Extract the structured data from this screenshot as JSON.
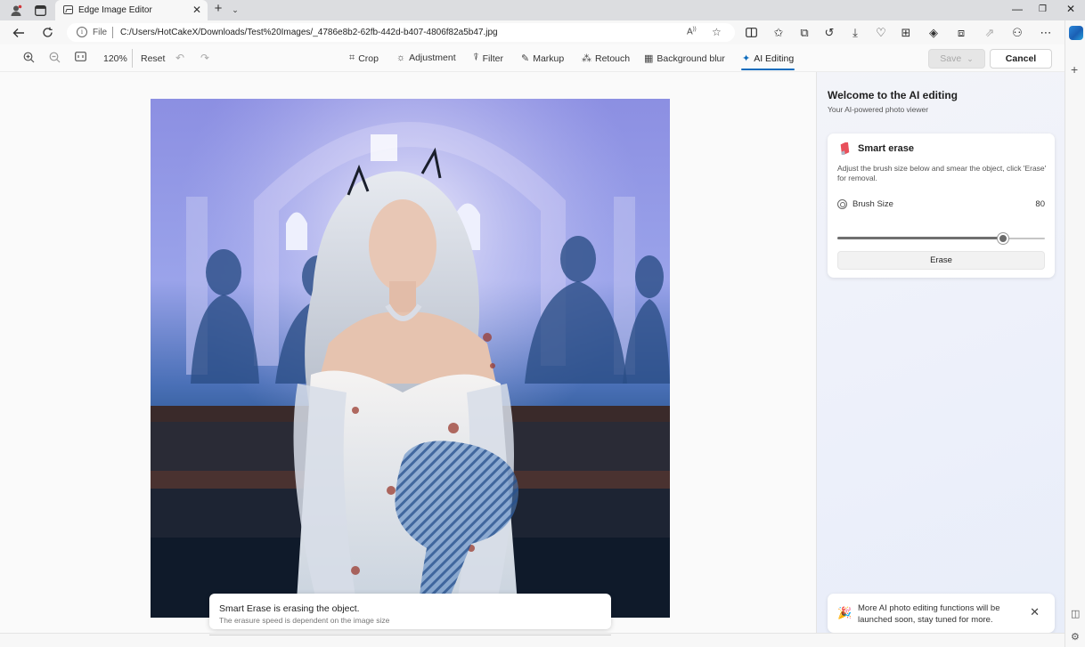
{
  "tab": {
    "title": "Edge Image Editor"
  },
  "address": {
    "scheme_label": "File",
    "url": "C:/Users/HotCakeX/Downloads/Test%20Images/_4786e8b2-62fb-442d-b407-4806f82a5b47.jpg"
  },
  "toolbar": {
    "zoom": "120%",
    "reset": "Reset",
    "crop": "Crop",
    "adjustment": "Adjustment",
    "filter": "Filter",
    "markup": "Markup",
    "retouch": "Retouch",
    "background_blur": "Background blur",
    "ai_editing": "AI Editing",
    "save": "Save",
    "cancel": "Cancel"
  },
  "toast": {
    "title": "Smart Erase is erasing the object.",
    "subtitle": "The erasure speed is dependent on the image size"
  },
  "panel": {
    "title": "Welcome to the AI editing",
    "subtitle": "Your AI-powered photo viewer",
    "smart_erase": {
      "title": "Smart erase",
      "description": "Adjust the brush size below and smear the object, click 'Erase' for removal.",
      "brush_label": "Brush Size",
      "brush_value": "80",
      "brush_fraction": 0.8,
      "erase_button": "Erase"
    },
    "notice": {
      "text": "More AI photo editing functions will be launched soon, stay tuned for more."
    }
  },
  "colors": {
    "accent": "#0f6cbd",
    "panel_bg": "#eef1fa"
  }
}
